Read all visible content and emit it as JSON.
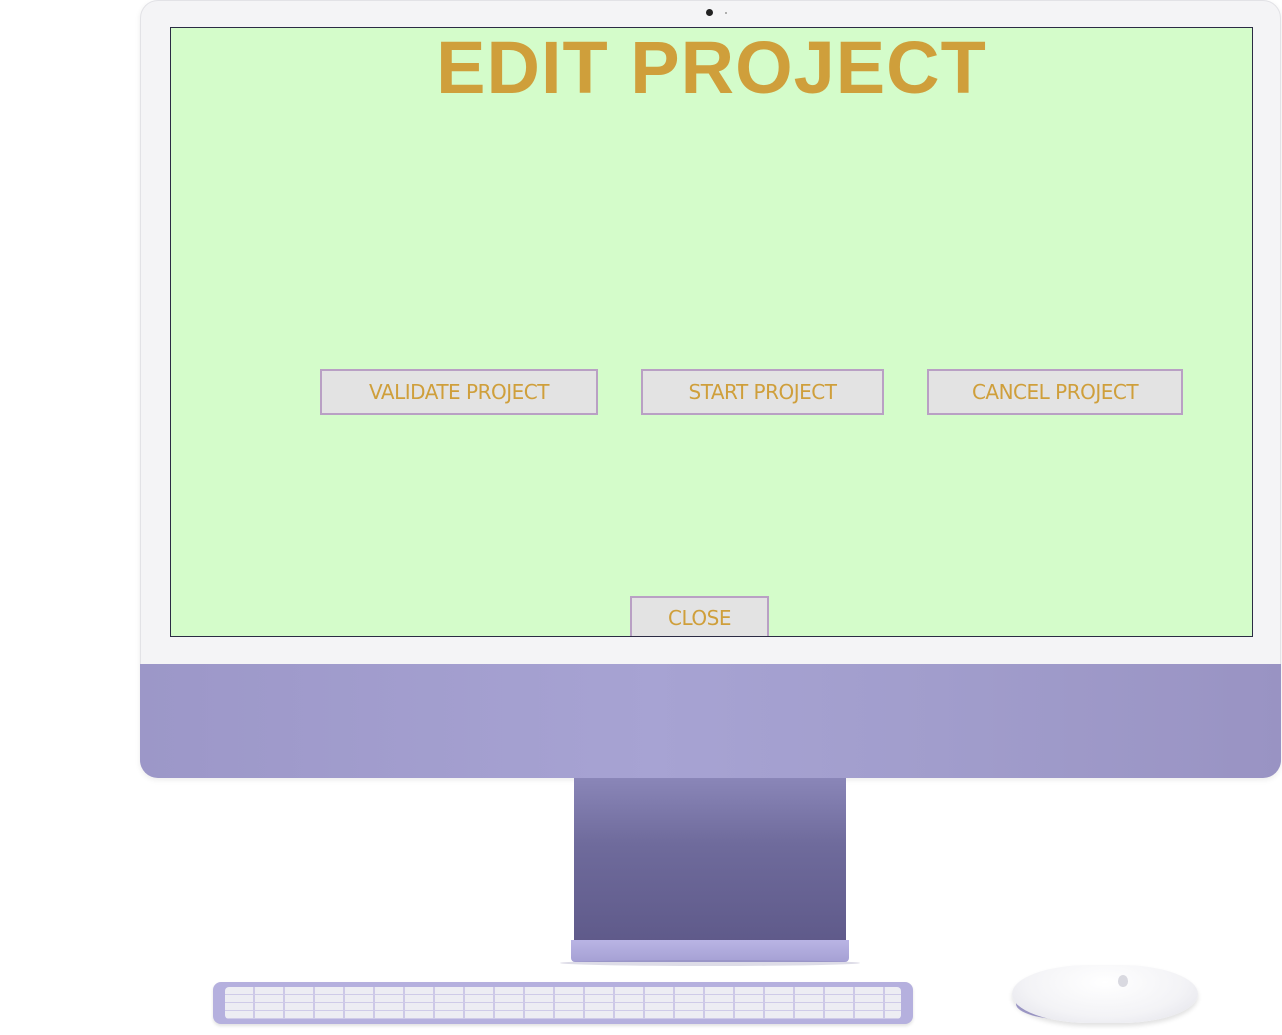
{
  "window": {
    "title": "EDIT PROJECT"
  },
  "actions": {
    "validate_label": "VALIDATE PROJECT",
    "start_label": "START PROJECT",
    "cancel_label": "CANCEL PROJECT",
    "close_label": "CLOSE"
  },
  "colors": {
    "screen_background": "#d4fcca",
    "accent_text": "#cf9f3b",
    "button_background": "#e3e3e3",
    "button_border": "#b9a0c4",
    "device_purple": "#a5a0d0"
  },
  "icons": {
    "camera": "camera-icon",
    "mouse_logo": "apple-logo-icon"
  }
}
